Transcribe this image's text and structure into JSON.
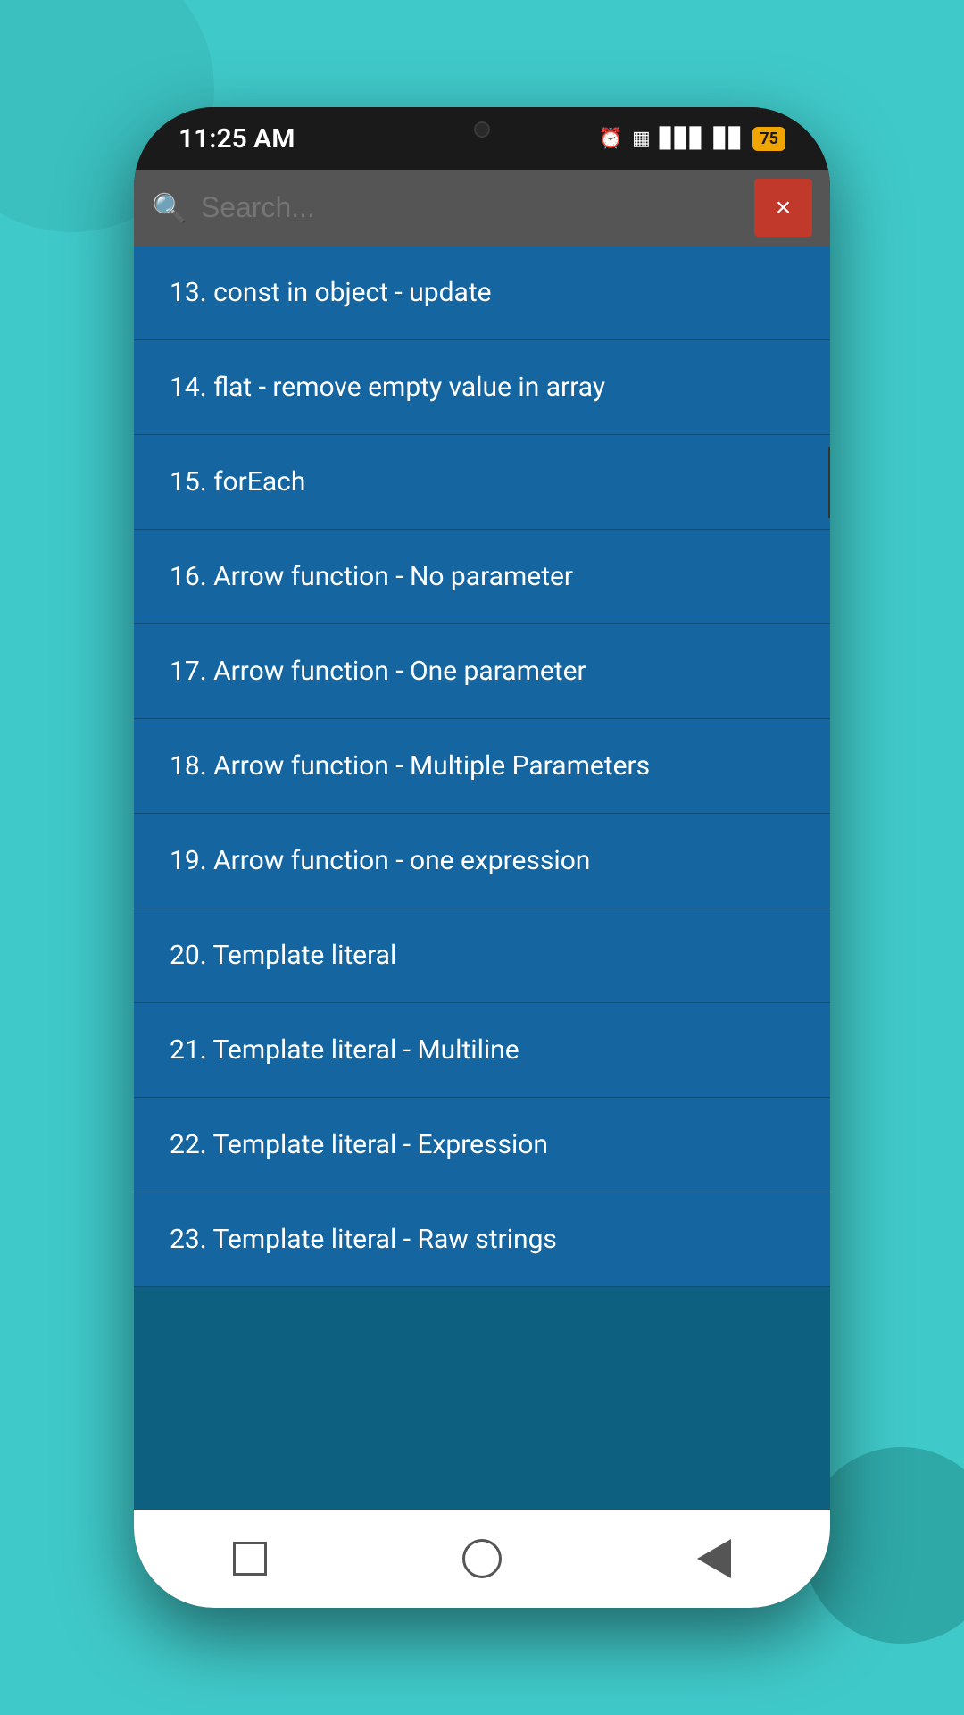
{
  "background": {
    "color": "#40c9c9"
  },
  "statusBar": {
    "time": "11:25 AM",
    "batteryLevel": "75"
  },
  "searchBar": {
    "placeholder": "Search...",
    "clearButtonLabel": "×"
  },
  "listItems": [
    {
      "id": 13,
      "label": "13. const in object - update"
    },
    {
      "id": 14,
      "label": "14. flat - remove empty value in array"
    },
    {
      "id": 15,
      "label": "15. forEach"
    },
    {
      "id": 16,
      "label": "16. Arrow function - No parameter"
    },
    {
      "id": 17,
      "label": "17. Arrow function - One parameter"
    },
    {
      "id": 18,
      "label": "18. Arrow function - Multiple Parameters"
    },
    {
      "id": 19,
      "label": "19. Arrow function - one expression"
    },
    {
      "id": 20,
      "label": "20. Template literal"
    },
    {
      "id": 21,
      "label": "21. Template literal - Multiline"
    },
    {
      "id": 22,
      "label": "22. Template literal - Expression"
    },
    {
      "id": 23,
      "label": "23. Template literal - Raw strings"
    }
  ],
  "bottomNav": {
    "squareLabel": "recents",
    "circleLabel": "home",
    "triangleLabel": "back"
  }
}
